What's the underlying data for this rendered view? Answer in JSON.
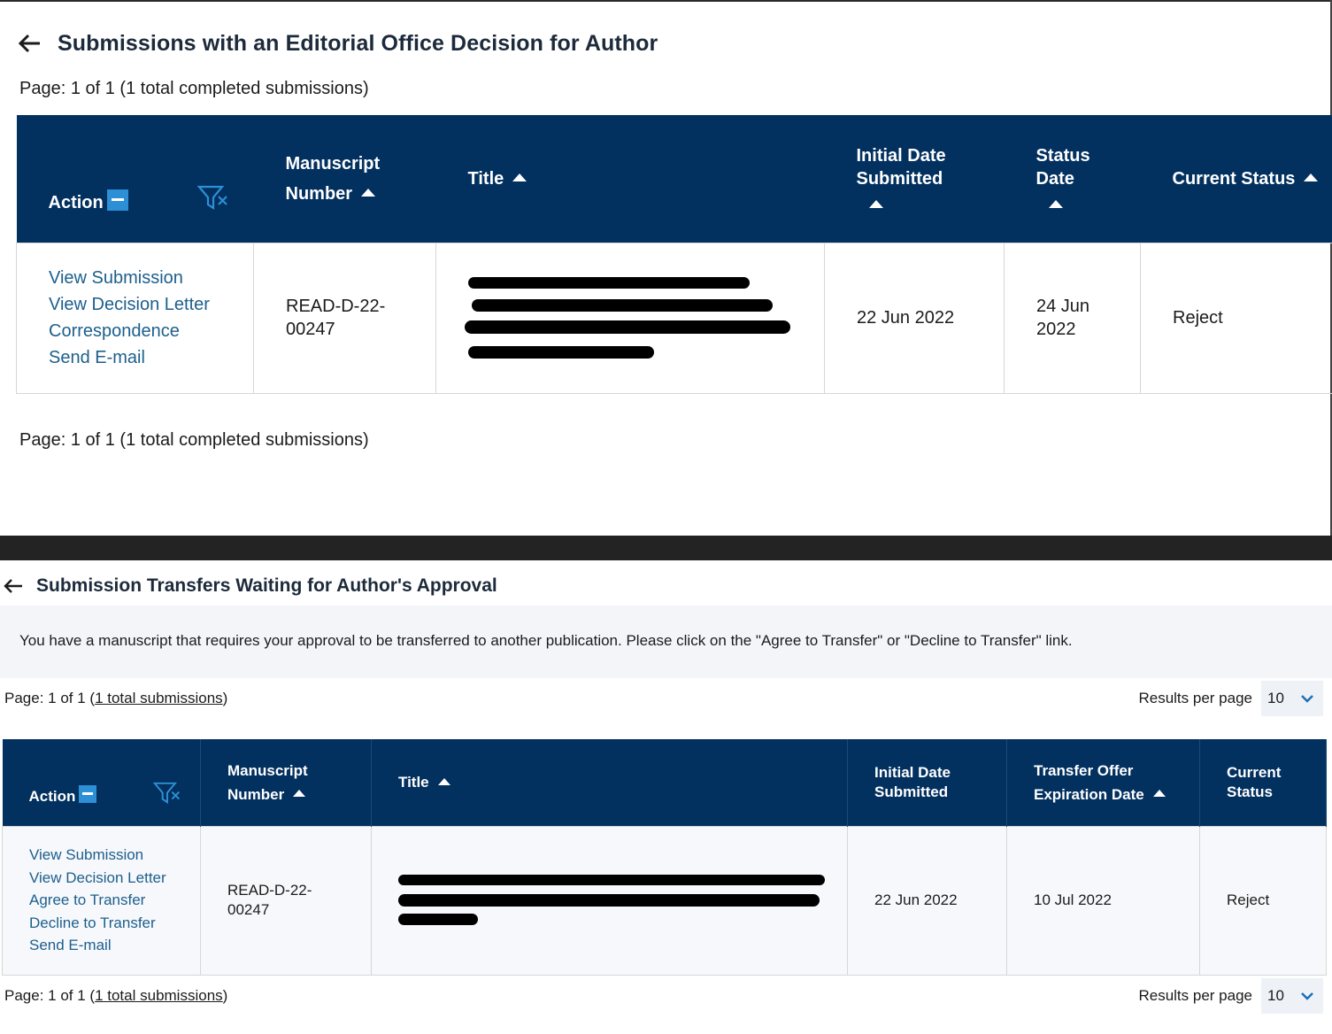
{
  "section1": {
    "title": "Submissions with an Editorial Office Decision for Author",
    "page_info_top": "Page: 1 of 1 (1 total completed submissions)",
    "page_info_bottom": "Page: 1 of 1 (1 total completed submissions)",
    "columns": {
      "action": "Action",
      "manuscript_l1": "Manuscript",
      "manuscript_l2": "Number",
      "title": "Title",
      "initial_l1": "Initial Date",
      "initial_l2": "Submitted",
      "status_l1": "Status",
      "status_l2": "Date",
      "current_status": "Current Status"
    },
    "row": {
      "actions": [
        "View Submission",
        "View Decision Letter",
        "Correspondence",
        "Send E-mail"
      ],
      "manuscript_l1": "READ-D-22-",
      "manuscript_l2": "00247",
      "initial_date": "22 Jun 2022",
      "status_l1": "24 Jun",
      "status_l2": "2022",
      "current_status": "Reject"
    }
  },
  "section2": {
    "title": "Submission Transfers Waiting for Author's Approval",
    "notice": "You have a manuscript that requires your approval to be transferred to another publication. Please click on the \"Agree to Transfer\" or \"Decline to Transfer\" link.",
    "page_prefix": "Page: 1 of 1 (",
    "page_link": "1 total submissions",
    "page_suffix": ")",
    "results_label": "Results per page",
    "results_value": "10",
    "columns": {
      "action": "Action",
      "manuscript_l1": "Manuscript",
      "manuscript_l2": "Number",
      "title": "Title",
      "initial_l1": "Initial Date",
      "initial_l2": "Submitted",
      "transfer_l1": "Transfer Offer",
      "transfer_l2": "Expiration Date",
      "current_l1": "Current",
      "current_l2": "Status"
    },
    "row": {
      "actions": [
        "View Submission",
        "View Decision Letter",
        "Agree to Transfer",
        "Decline to Transfer",
        "Send E-mail"
      ],
      "manuscript_l1": "READ-D-22-",
      "manuscript_l2": "00247",
      "initial_date": "22 Jun 2022",
      "expiration_date": "10 Jul 2022",
      "current_status": "Reject"
    }
  },
  "colors": {
    "header_bg": "#02305f",
    "link": "#1c5f8d",
    "accent": "#2d8fd5"
  }
}
